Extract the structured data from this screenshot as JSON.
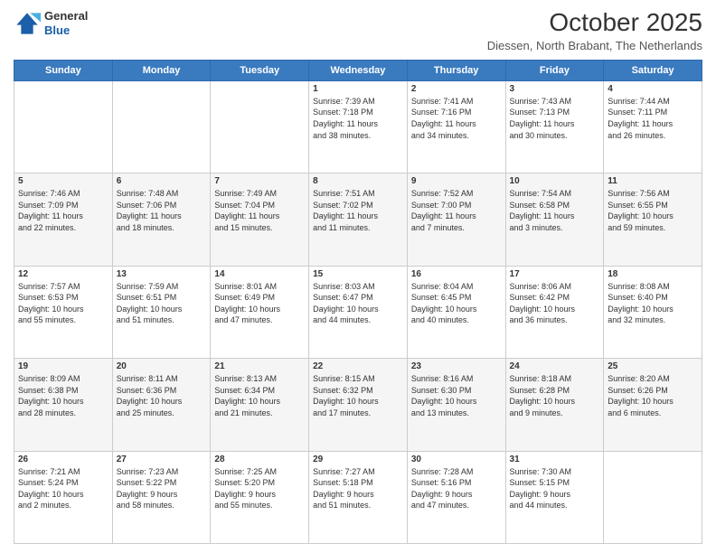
{
  "logo": {
    "line1": "General",
    "line2": "Blue"
  },
  "header": {
    "title": "October 2025",
    "subtitle": "Diessen, North Brabant, The Netherlands"
  },
  "weekdays": [
    "Sunday",
    "Monday",
    "Tuesday",
    "Wednesday",
    "Thursday",
    "Friday",
    "Saturday"
  ],
  "weeks": [
    [
      {
        "day": "",
        "content": ""
      },
      {
        "day": "",
        "content": ""
      },
      {
        "day": "",
        "content": ""
      },
      {
        "day": "1",
        "content": "Sunrise: 7:39 AM\nSunset: 7:18 PM\nDaylight: 11 hours\nand 38 minutes."
      },
      {
        "day": "2",
        "content": "Sunrise: 7:41 AM\nSunset: 7:16 PM\nDaylight: 11 hours\nand 34 minutes."
      },
      {
        "day": "3",
        "content": "Sunrise: 7:43 AM\nSunset: 7:13 PM\nDaylight: 11 hours\nand 30 minutes."
      },
      {
        "day": "4",
        "content": "Sunrise: 7:44 AM\nSunset: 7:11 PM\nDaylight: 11 hours\nand 26 minutes."
      }
    ],
    [
      {
        "day": "5",
        "content": "Sunrise: 7:46 AM\nSunset: 7:09 PM\nDaylight: 11 hours\nand 22 minutes."
      },
      {
        "day": "6",
        "content": "Sunrise: 7:48 AM\nSunset: 7:06 PM\nDaylight: 11 hours\nand 18 minutes."
      },
      {
        "day": "7",
        "content": "Sunrise: 7:49 AM\nSunset: 7:04 PM\nDaylight: 11 hours\nand 15 minutes."
      },
      {
        "day": "8",
        "content": "Sunrise: 7:51 AM\nSunset: 7:02 PM\nDaylight: 11 hours\nand 11 minutes."
      },
      {
        "day": "9",
        "content": "Sunrise: 7:52 AM\nSunset: 7:00 PM\nDaylight: 11 hours\nand 7 minutes."
      },
      {
        "day": "10",
        "content": "Sunrise: 7:54 AM\nSunset: 6:58 PM\nDaylight: 11 hours\nand 3 minutes."
      },
      {
        "day": "11",
        "content": "Sunrise: 7:56 AM\nSunset: 6:55 PM\nDaylight: 10 hours\nand 59 minutes."
      }
    ],
    [
      {
        "day": "12",
        "content": "Sunrise: 7:57 AM\nSunset: 6:53 PM\nDaylight: 10 hours\nand 55 minutes."
      },
      {
        "day": "13",
        "content": "Sunrise: 7:59 AM\nSunset: 6:51 PM\nDaylight: 10 hours\nand 51 minutes."
      },
      {
        "day": "14",
        "content": "Sunrise: 8:01 AM\nSunset: 6:49 PM\nDaylight: 10 hours\nand 47 minutes."
      },
      {
        "day": "15",
        "content": "Sunrise: 8:03 AM\nSunset: 6:47 PM\nDaylight: 10 hours\nand 44 minutes."
      },
      {
        "day": "16",
        "content": "Sunrise: 8:04 AM\nSunset: 6:45 PM\nDaylight: 10 hours\nand 40 minutes."
      },
      {
        "day": "17",
        "content": "Sunrise: 8:06 AM\nSunset: 6:42 PM\nDaylight: 10 hours\nand 36 minutes."
      },
      {
        "day": "18",
        "content": "Sunrise: 8:08 AM\nSunset: 6:40 PM\nDaylight: 10 hours\nand 32 minutes."
      }
    ],
    [
      {
        "day": "19",
        "content": "Sunrise: 8:09 AM\nSunset: 6:38 PM\nDaylight: 10 hours\nand 28 minutes."
      },
      {
        "day": "20",
        "content": "Sunrise: 8:11 AM\nSunset: 6:36 PM\nDaylight: 10 hours\nand 25 minutes."
      },
      {
        "day": "21",
        "content": "Sunrise: 8:13 AM\nSunset: 6:34 PM\nDaylight: 10 hours\nand 21 minutes."
      },
      {
        "day": "22",
        "content": "Sunrise: 8:15 AM\nSunset: 6:32 PM\nDaylight: 10 hours\nand 17 minutes."
      },
      {
        "day": "23",
        "content": "Sunrise: 8:16 AM\nSunset: 6:30 PM\nDaylight: 10 hours\nand 13 minutes."
      },
      {
        "day": "24",
        "content": "Sunrise: 8:18 AM\nSunset: 6:28 PM\nDaylight: 10 hours\nand 9 minutes."
      },
      {
        "day": "25",
        "content": "Sunrise: 8:20 AM\nSunset: 6:26 PM\nDaylight: 10 hours\nand 6 minutes."
      }
    ],
    [
      {
        "day": "26",
        "content": "Sunrise: 7:21 AM\nSunset: 5:24 PM\nDaylight: 10 hours\nand 2 minutes."
      },
      {
        "day": "27",
        "content": "Sunrise: 7:23 AM\nSunset: 5:22 PM\nDaylight: 9 hours\nand 58 minutes."
      },
      {
        "day": "28",
        "content": "Sunrise: 7:25 AM\nSunset: 5:20 PM\nDaylight: 9 hours\nand 55 minutes."
      },
      {
        "day": "29",
        "content": "Sunrise: 7:27 AM\nSunset: 5:18 PM\nDaylight: 9 hours\nand 51 minutes."
      },
      {
        "day": "30",
        "content": "Sunrise: 7:28 AM\nSunset: 5:16 PM\nDaylight: 9 hours\nand 47 minutes."
      },
      {
        "day": "31",
        "content": "Sunrise: 7:30 AM\nSunset: 5:15 PM\nDaylight: 9 hours\nand 44 minutes."
      },
      {
        "day": "",
        "content": ""
      }
    ]
  ]
}
